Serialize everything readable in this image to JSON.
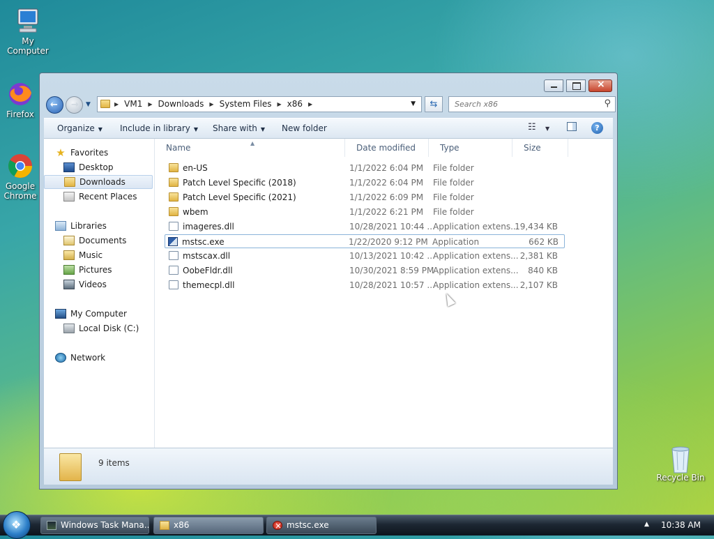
{
  "desktop": {
    "icons": [
      {
        "label": "My Computer"
      },
      {
        "label": "Firefox"
      },
      {
        "label": "Google Chrome"
      },
      {
        "label": "Recycle Bin"
      }
    ]
  },
  "window": {
    "address": {
      "crumbs": [
        "VM1",
        "Downloads",
        "System Files",
        "x86"
      ]
    },
    "search": {
      "placeholder": "Search x86"
    },
    "toolbar": {
      "organize": "Organize",
      "include_in_library": "Include in library",
      "share_with": "Share with",
      "new_folder": "New folder"
    },
    "nav": {
      "favorites": "Favorites",
      "desktop": "Desktop",
      "downloads": "Downloads",
      "recent_places": "Recent Places",
      "libraries": "Libraries",
      "documents": "Documents",
      "music": "Music",
      "pictures": "Pictures",
      "videos": "Videos",
      "my_computer": "My Computer",
      "local_disk": "Local Disk (C:)",
      "network": "Network"
    },
    "columns": {
      "name": "Name",
      "date": "Date modified",
      "type": "Type",
      "size": "Size"
    },
    "files": [
      {
        "name": "en-US",
        "date": "1/1/2022 6:04 PM",
        "type": "File folder",
        "size": "",
        "icon": "folder-icon"
      },
      {
        "name": "Patch Level Specific (2018)",
        "date": "1/1/2022 6:04 PM",
        "type": "File folder",
        "size": "",
        "icon": "folder-icon"
      },
      {
        "name": "Patch Level Specific (2021)",
        "date": "1/1/2022 6:09 PM",
        "type": "File folder",
        "size": "",
        "icon": "folder-icon"
      },
      {
        "name": "wbem",
        "date": "1/1/2022 6:21 PM",
        "type": "File folder",
        "size": "",
        "icon": "folder-icon"
      },
      {
        "name": "imageres.dll",
        "date": "10/28/2021 10:44 ...",
        "type": "Application extens...",
        "size": "19,434 KB",
        "icon": "dll-icon"
      },
      {
        "name": "mstsc.exe",
        "date": "1/22/2020 9:12 PM",
        "type": "Application",
        "size": "662 KB",
        "icon": "exe-icon"
      },
      {
        "name": "mstscax.dll",
        "date": "10/13/2021 10:42 ...",
        "type": "Application extens...",
        "size": "2,381 KB",
        "icon": "dll-icon"
      },
      {
        "name": "OobeFldr.dll",
        "date": "10/30/2021 8:59 PM",
        "type": "Application extens...",
        "size": "840 KB",
        "icon": "dll-icon"
      },
      {
        "name": "themecpl.dll",
        "date": "10/28/2021 10:57 ...",
        "type": "Application extens...",
        "size": "2,107 KB",
        "icon": "dll-icon"
      }
    ],
    "selected_file": "mstsc.exe",
    "status": {
      "count": "9 items"
    }
  },
  "taskbar": {
    "tasks": [
      {
        "label": "Windows Task Mana...",
        "icon": "task-manager-icon"
      },
      {
        "label": "x86",
        "icon": "folder-icon"
      },
      {
        "label": "mstsc.exe",
        "icon": "error-icon"
      }
    ],
    "clock": "10:38 AM"
  }
}
